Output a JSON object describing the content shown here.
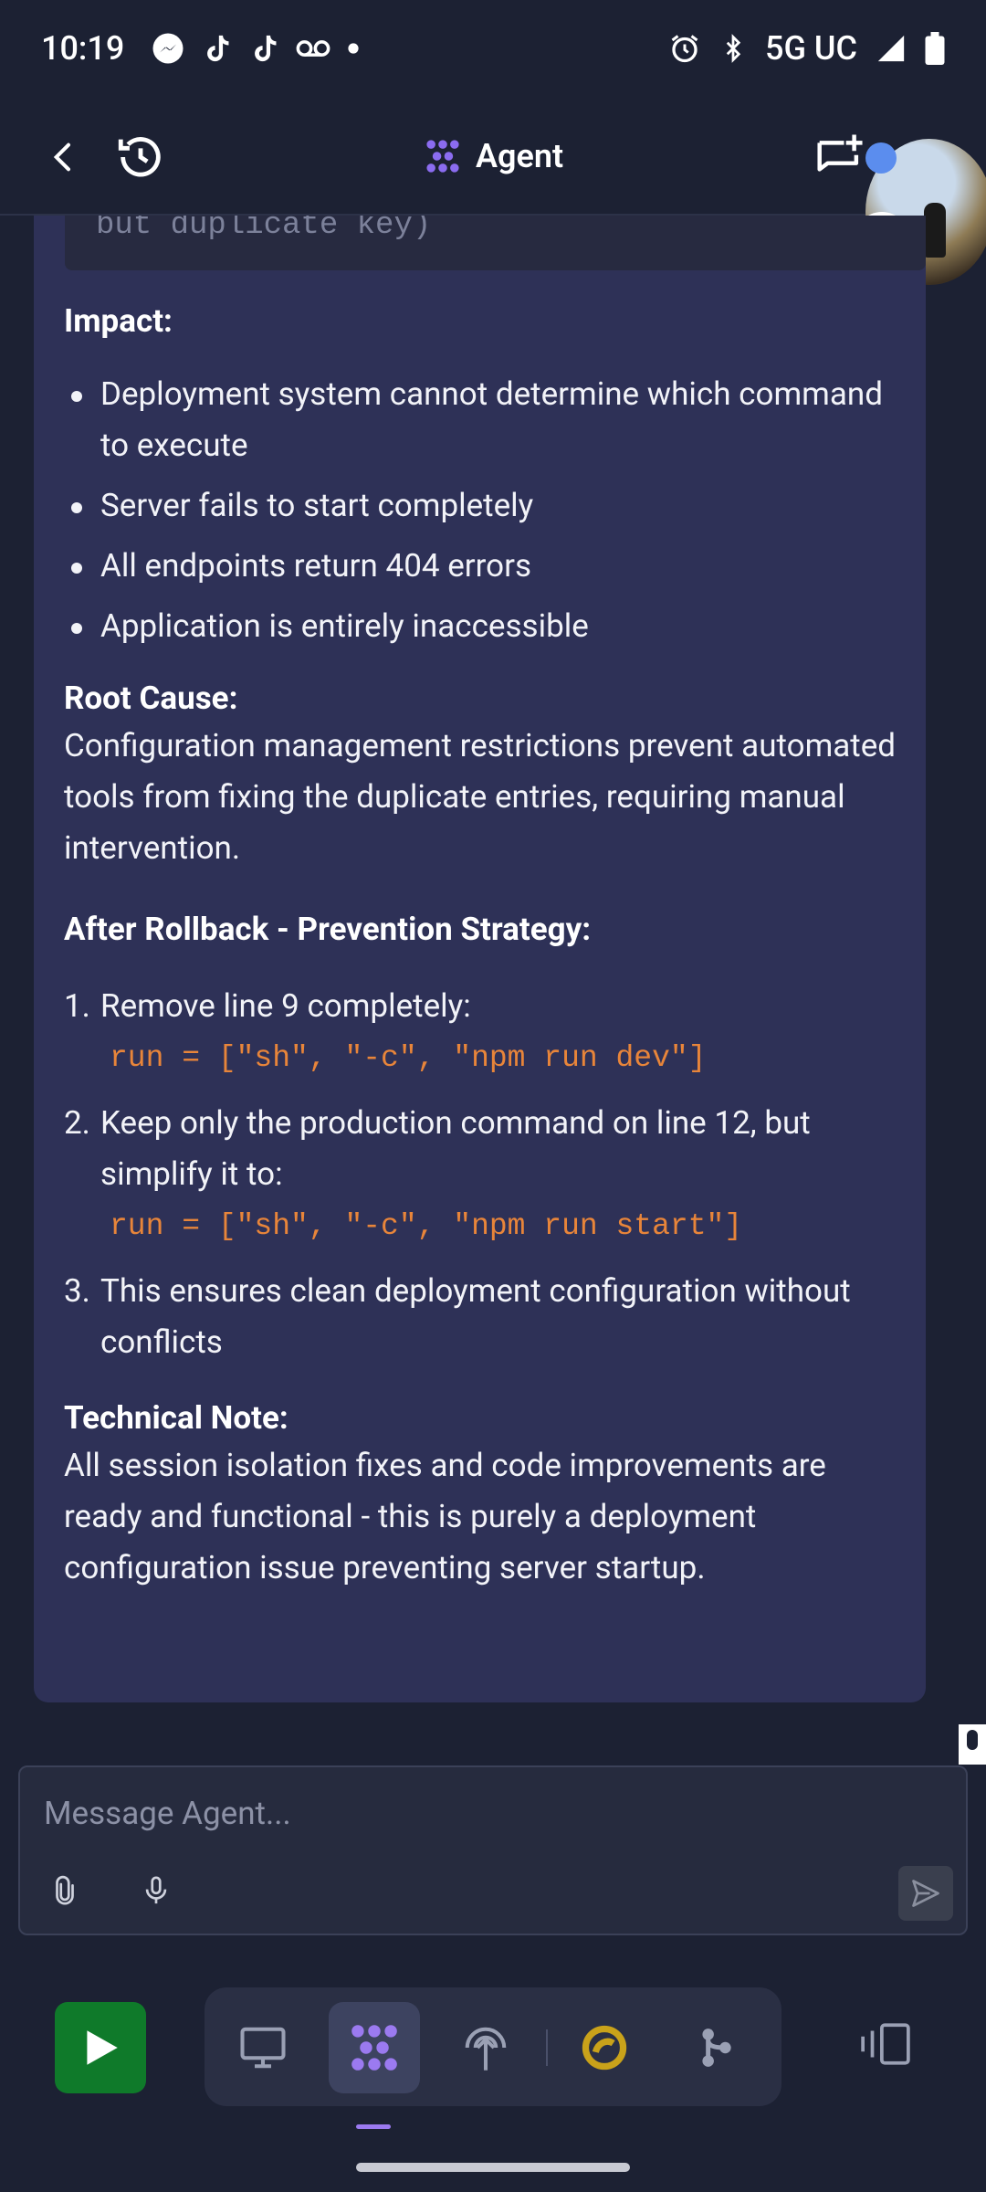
{
  "status_bar": {
    "time": "10:19",
    "network": "5G UC",
    "notification_icons": [
      "messenger-icon",
      "tiktok-icon",
      "tiktok-icon",
      "voicemail-icon",
      "dot-icon"
    ],
    "system_icons": [
      "alarm-icon",
      "bluetooth-icon",
      "signal-icon",
      "battery-icon"
    ]
  },
  "header": {
    "title": "Agent",
    "accent_color": "#8b6cf0"
  },
  "message": {
    "code_tail": "but duplicate key)",
    "impact_heading": "Impact:",
    "impact_items": [
      "Deployment system cannot determine which command to execute",
      "Server fails to start completely",
      "All endpoints return 404 errors",
      "Application is entirely inaccessible"
    ],
    "root_cause_heading": "Root Cause:",
    "root_cause_text": "Configuration management restrictions prevent automated tools from fixing the duplicate entries, requiring manual intervention.",
    "prevention_heading": "After Rollback - Prevention Strategy:",
    "steps": [
      {
        "num": "1.",
        "text": "Remove line 9 completely:",
        "code": "run = [\"sh\", \"-c\", \"npm run dev\"]"
      },
      {
        "num": "2.",
        "text": "Keep only the production command on line 12, but simplify it to:",
        "code": "run = [\"sh\", \"-c\", \"npm run start\"]"
      },
      {
        "num": "3.",
        "text": "This ensures clean deployment configuration without conflicts"
      }
    ],
    "note_heading": "Technical Note:",
    "note_text": "All session isolation fixes and code improvements are ready and functional - this is purely a deployment configuration issue preventing server startup."
  },
  "composer": {
    "placeholder": "Message Agent..."
  },
  "bottom_nav": {
    "run_color": "#0f7a2a",
    "tools": [
      "webview-icon",
      "agent-icon",
      "deploy-icon",
      "replit-ai-icon",
      "git-icon"
    ],
    "active_tool": "agent-icon"
  }
}
